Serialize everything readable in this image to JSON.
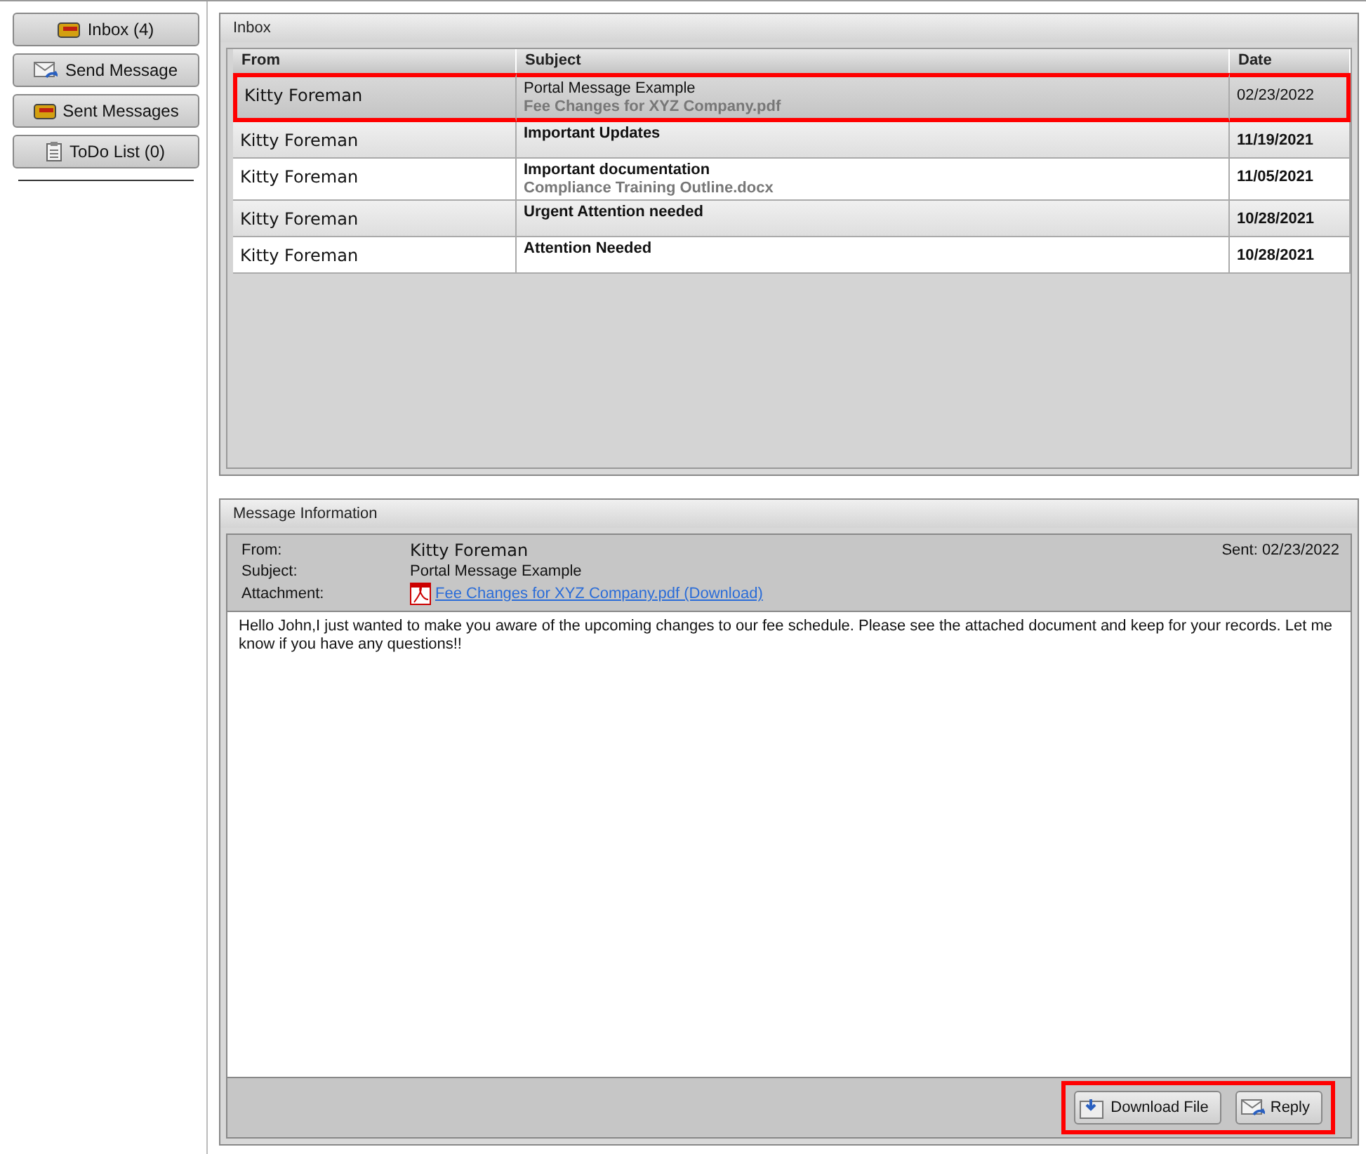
{
  "sidebar": {
    "items": [
      {
        "label": "Inbox (4)"
      },
      {
        "label": "Send Message"
      },
      {
        "label": "Sent Messages"
      },
      {
        "label": "ToDo List (0)"
      }
    ]
  },
  "inbox": {
    "title": "Inbox",
    "columns": [
      "From",
      "Subject",
      "Date"
    ],
    "rows": [
      {
        "from": "Kitty Foreman",
        "subject": "Portal Message Example",
        "attachment": "Fee Changes for XYZ Company.pdf",
        "date": "02/23/2022",
        "unread": false,
        "selected": true,
        "highlighted": true
      },
      {
        "from": "Kitty Foreman",
        "subject": "Important Updates",
        "date": "11/19/2021",
        "unread": true,
        "selected": false,
        "highlighted": false
      },
      {
        "from": "Kitty Foreman",
        "subject": "Important documentation",
        "attachment": "Compliance Training Outline.docx",
        "date": "11/05/2021",
        "unread": true,
        "selected": false,
        "highlighted": false
      },
      {
        "from": "Kitty Foreman",
        "subject": "Urgent Attention needed",
        "date": "10/28/2021",
        "unread": true,
        "selected": false,
        "highlighted": false
      },
      {
        "from": "Kitty Foreman",
        "subject": "Attention Needed",
        "date": "10/28/2021",
        "unread": true,
        "selected": false,
        "highlighted": false
      }
    ]
  },
  "message": {
    "title": "Message Information",
    "from_label": "From:",
    "from": "Kitty Foreman",
    "sent": "Sent: 02/23/2022",
    "subject_label": "Subject:",
    "subject": "Portal Message Example",
    "attachment_label": "Attachment:",
    "attachment_link": "Fee Changes for XYZ Company.pdf (Download)",
    "body": "Hello John,I just wanted to make you aware of the upcoming changes to our fee schedule. Please see the attached document and keep for your records. Let me know if you have any questions!!",
    "buttons_highlighted": true,
    "buttons": [
      {
        "label": "Download File"
      },
      {
        "label": "Reply"
      }
    ]
  }
}
